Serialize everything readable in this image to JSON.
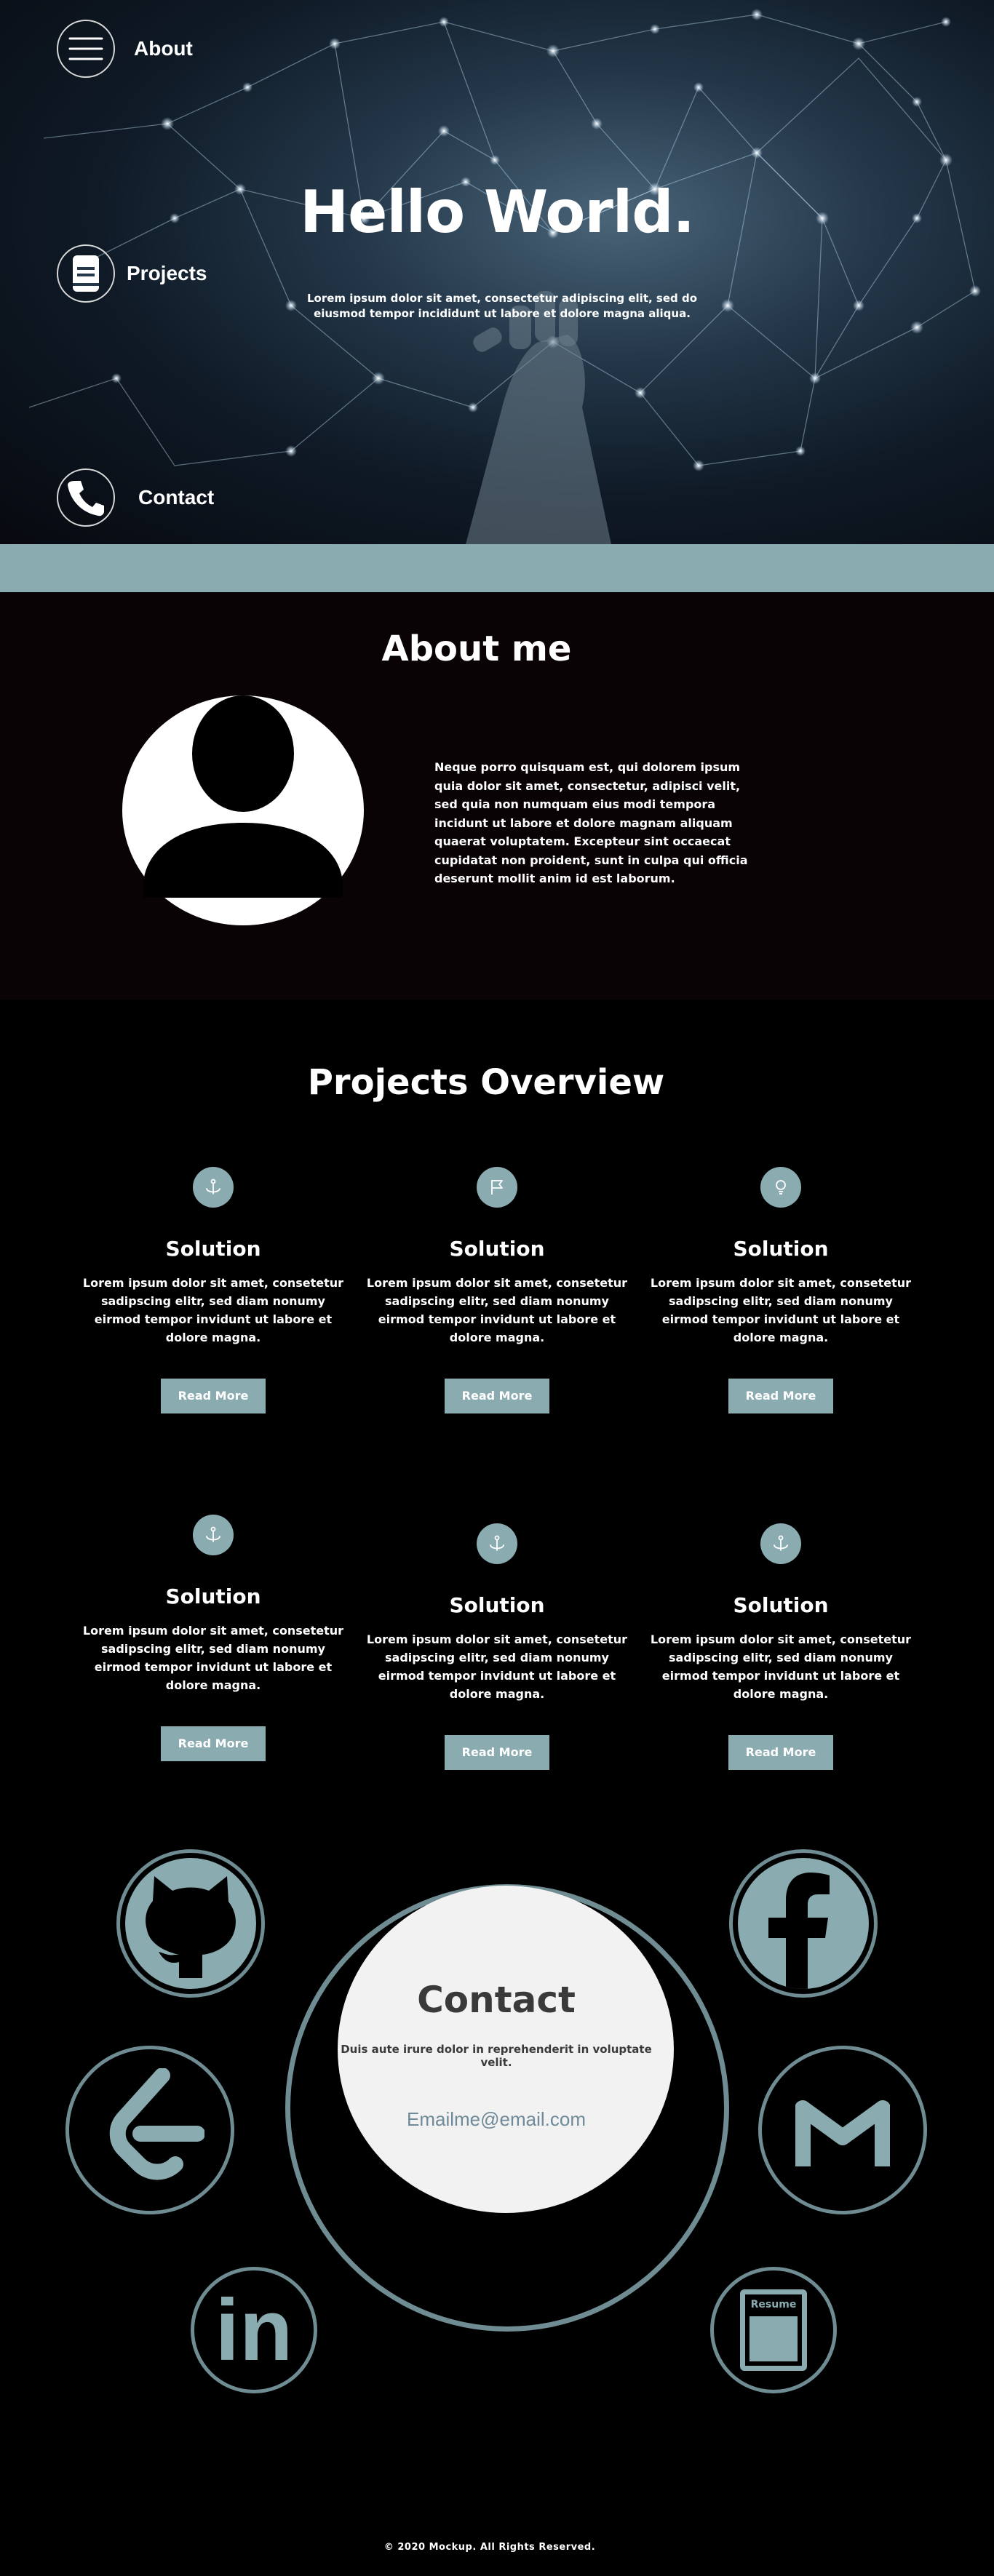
{
  "nav": {
    "items": [
      {
        "label": "About",
        "icon": "menu-icon"
      },
      {
        "label": "Projects",
        "icon": "book-icon"
      },
      {
        "label": "Contact",
        "icon": "phone-icon"
      }
    ]
  },
  "hero": {
    "title": "Hello World.",
    "subtitle": "Lorem ipsum dolor sit amet, consectetur adipiscing elit, sed do eiusmod tempor incididunt ut labore et dolore magna aliqua."
  },
  "about": {
    "title": "About me",
    "text": "Neque porro quisquam est, qui dolorem ipsum quia dolor sit amet, consectetur, adipisci velit, sed quia non numquam eius modi tempora incidunt ut labore et dolore magnam aliquam quaerat voluptatem. Excepteur sint occaecat cupidatat non proident, sunt in culpa qui officia deserunt mollit anim id est laborum."
  },
  "projects": {
    "title": "Projects Overview",
    "cards": [
      {
        "icon": "anchor-icon",
        "title": "Solution",
        "text": "Lorem ipsum dolor sit amet, consetetur sadipscing elitr, sed diam nonumy eirmod tempor invidunt ut labore et dolore magna.",
        "button": "Read More"
      },
      {
        "icon": "flag-icon",
        "title": "Solution",
        "text": "Lorem ipsum dolor sit amet, consetetur sadipscing elitr, sed diam nonumy eirmod tempor invidunt ut labore et dolore magna.",
        "button": "Read More"
      },
      {
        "icon": "lightbulb-icon",
        "title": "Solution",
        "text": "Lorem ipsum dolor sit amet, consetetur sadipscing elitr, sed diam nonumy eirmod tempor invidunt ut labore et dolore magna.",
        "button": "Read More"
      },
      {
        "icon": "anchor-icon",
        "title": "Solution",
        "text": "Lorem ipsum dolor sit amet, consetetur sadipscing elitr, sed diam nonumy eirmod tempor invidunt ut labore et dolore magna.",
        "button": "Read More"
      },
      {
        "icon": "anchor-icon",
        "title": "Solution",
        "text": "Lorem ipsum dolor sit amet, consetetur sadipscing elitr, sed diam nonumy eirmod tempor invidunt ut labore et dolore magna.",
        "button": "Read More"
      },
      {
        "icon": "anchor-icon",
        "title": "Solution",
        "text": "Lorem ipsum dolor sit amet, consetetur sadipscing elitr, sed diam nonumy eirmod tempor invidunt ut labore et dolore magna.",
        "button": "Read More"
      }
    ]
  },
  "contact": {
    "title": "Contact",
    "subtitle": "Duis aute irure dolor in reprehenderit in voluptate velit.",
    "email": "Emailme@email.com",
    "social": [
      {
        "name": "github-icon"
      },
      {
        "name": "facebook-icon"
      },
      {
        "name": "leetcode-icon"
      },
      {
        "name": "gmail-icon"
      },
      {
        "name": "linkedin-icon",
        "label": "in"
      },
      {
        "name": "resume-icon",
        "label": "Resume"
      }
    ]
  },
  "footer": {
    "text": "© 2020 Mockup.  All Rights Reserved."
  },
  "colors": {
    "accent": "#8aacb1",
    "ring": "#6f8c92",
    "background": "#000000",
    "contact_bg": "#f2f2f2"
  }
}
